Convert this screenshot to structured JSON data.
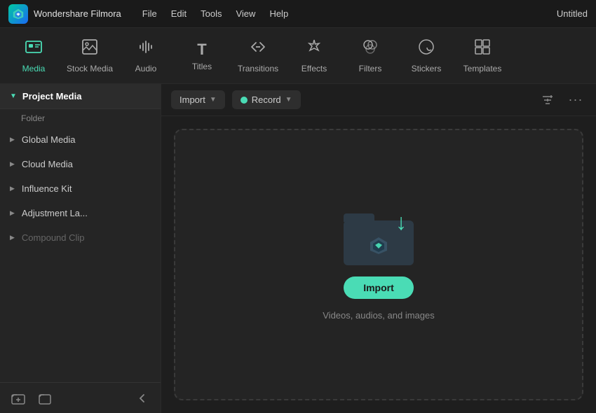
{
  "titlebar": {
    "app_name": "Wondershare Filmora",
    "menu": [
      "File",
      "Edit",
      "Tools",
      "View",
      "Help"
    ],
    "title": "Untitled"
  },
  "toolbar": {
    "items": [
      {
        "id": "media",
        "label": "Media",
        "icon": "🖼"
      },
      {
        "id": "stock-media",
        "label": "Stock Media",
        "icon": "📁"
      },
      {
        "id": "audio",
        "label": "Audio",
        "icon": "🎵"
      },
      {
        "id": "titles",
        "label": "Titles",
        "icon": "T"
      },
      {
        "id": "transitions",
        "label": "Transitions",
        "icon": "↔"
      },
      {
        "id": "effects",
        "label": "Effects",
        "icon": "✨"
      },
      {
        "id": "filters",
        "label": "Filters",
        "icon": "🎨"
      },
      {
        "id": "stickers",
        "label": "Stickers",
        "icon": "⭐"
      },
      {
        "id": "templates",
        "label": "Templates",
        "icon": "⊞"
      }
    ]
  },
  "sidebar": {
    "header_label": "Project Media",
    "folder_label": "Folder",
    "items": [
      {
        "label": "Global Media"
      },
      {
        "label": "Cloud Media"
      },
      {
        "label": "Influence Kit"
      },
      {
        "label": "Adjustment La..."
      },
      {
        "label": "Compound Clip"
      }
    ]
  },
  "content_toolbar": {
    "import_label": "Import",
    "record_label": "Record"
  },
  "dropzone": {
    "import_btn_label": "Import",
    "description": "Videos, audios, and images"
  }
}
